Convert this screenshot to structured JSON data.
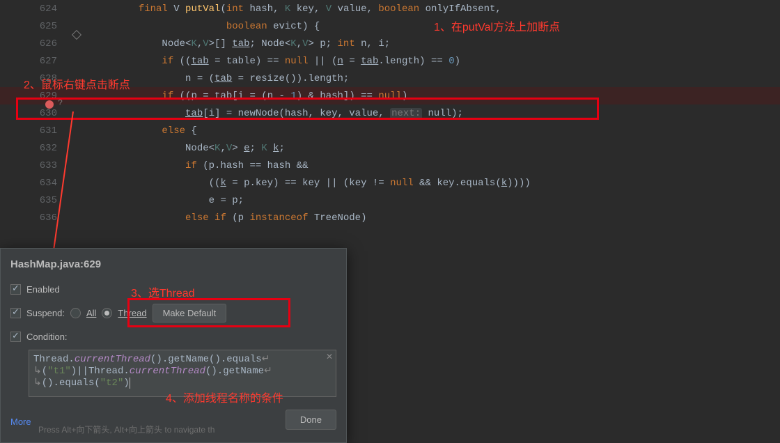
{
  "editor": {
    "lines": [
      {
        "n": "624"
      },
      {
        "n": "625"
      },
      {
        "n": "626"
      },
      {
        "n": "627"
      },
      {
        "n": "628"
      },
      {
        "n": "629"
      },
      {
        "n": "630"
      },
      {
        "n": "631"
      },
      {
        "n": "632"
      },
      {
        "n": "633"
      },
      {
        "n": "634"
      },
      {
        "n": "635"
      },
      {
        "n": "636"
      }
    ],
    "code": {
      "l624": {
        "kw1": "final",
        "ty": "V",
        "method": "putVal",
        "kw2": "int",
        "p1": "hash, ",
        "ty2": "K",
        "p2": "key, ",
        "ty3": "V",
        "p3": "value, ",
        "kw3": "boolean",
        "p4": "onlyIfAbsent,"
      },
      "l625": {
        "kw": "boolean",
        "p": "evict) {"
      },
      "l626": {
        "a": "Node<",
        "g": "K",
        "c": ",",
        "g2": "V",
        "b": ">[] ",
        "tab": "tab",
        "semi": "; Node<",
        "g3": "K",
        "c2": ",",
        "g4": "V",
        "b2": "> p; ",
        "kw": "int",
        "rest": " n, i;"
      },
      "l627": {
        "kw": "if",
        "a": " ((",
        "tab": "tab",
        "b": " = table) == ",
        "kw2": "null",
        "c": " || (",
        "nn": "n",
        "d": " = ",
        "tab2": "tab",
        "e": ".length) == ",
        "num": "0",
        "f": ")"
      },
      "l628": {
        "a": "n = (",
        "tab": "tab",
        "b": " = resize()).length;"
      },
      "l629": {
        "kw": "if",
        "a": " ((p = ",
        "tab": "tab",
        "b": "[i = (",
        "nn": "n",
        "c": " - ",
        "num": "1",
        "d": ") & hash]) == ",
        "kw2": "null",
        "e": ")"
      },
      "l630": {
        "tab": "tab",
        "a": "[i] = newNode(hash, key, value, ",
        "hint": "next:",
        "b": " null);"
      },
      "l631": {
        "kw": "else",
        "a": " {"
      },
      "l632": {
        "a": "Node<",
        "g": "K",
        "c": ",",
        "g2": "V",
        "b": "> ",
        "e": "e",
        "semi": "; ",
        "ty": "K",
        "sp": " ",
        "k": "k",
        "end": ";"
      },
      "l633": {
        "kw": "if",
        "a": " (p.hash == hash &&"
      },
      "l634": {
        "a": "((",
        "k": "k",
        "b": " = p.key) == key || (key != ",
        "kw": "null",
        "c": " && key.equals(",
        "k2": "k",
        "d": "))))"
      },
      "l635": {
        "a": "e = p;"
      },
      "l636": {
        "kw": "else if",
        "a": " (p ",
        "kw2": "instanceof",
        "b": " TreeNode)"
      }
    }
  },
  "hidden": {
    "h1": "i] = n",
    "h2a": "<",
    "h2g": "K",
    "h2c": ",",
    "h2g2": "V",
    "h2b": ">",
    "h3": "p.hash",
    "h4a": "((",
    "h4k": "k",
    "h4b": " =",
    "h5": "e = p;"
  },
  "annotations": {
    "a1": "1、在putVal方法上加断点",
    "a2": "2、鼠标右键点击断点",
    "a3": "3、选Thread",
    "a4": "4、添加线程名称的条件"
  },
  "popup": {
    "title": "HashMap.java:629",
    "enabled_label": "Enabled",
    "suspend_label": "Suspend:",
    "all_label": "All",
    "thread_label": "Thread",
    "make_default": "Make Default",
    "condition_label": "Condition:",
    "cond_l1a": "Thread.",
    "cond_l1b": "currentThread",
    "cond_l1c": "().getName().equals",
    "cond_l2a": "(",
    "cond_l2b": "\"t1\"",
    "cond_l2c": ")||Thread.",
    "cond_l2d": "currentThread",
    "cond_l2e": "().getName",
    "cond_l3a": "().equals(",
    "cond_l3b": "\"t2\"",
    "cond_l3c": ")",
    "more": "More",
    "done": "Done",
    "hint": "Press Alt+向下箭头, Alt+向上箭头 to navigate th",
    "wrap": "↵",
    "cont": "↳"
  }
}
